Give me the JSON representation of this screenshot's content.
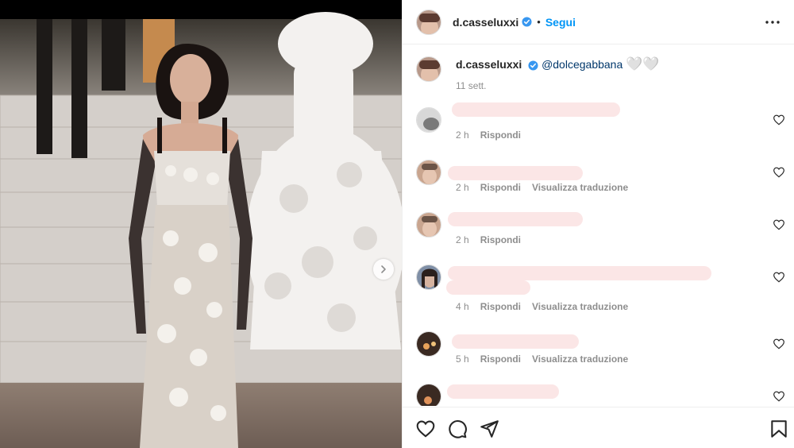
{
  "post": {
    "author": "d.casseluxxi",
    "dot": "•",
    "follow_label": "Segui",
    "more_icon": "more-horizontal-icon",
    "next_icon": "chevron-right-icon"
  },
  "caption": {
    "author": "d.casseluxxi",
    "mention": "@dolcegabbana",
    "emoji": "🤍🤍",
    "time": "11 sett."
  },
  "comments": [
    {
      "time": "2 h",
      "reply": "Rispondi",
      "translate": ""
    },
    {
      "time": "2 h",
      "reply": "Rispondi",
      "translate": "Visualizza traduzione"
    },
    {
      "time": "2 h",
      "reply": "Rispondi",
      "translate": ""
    },
    {
      "time": "4 h",
      "reply": "Rispondi",
      "translate": "Visualizza traduzione"
    },
    {
      "time": "5 h",
      "reply": "Rispondi",
      "translate": "Visualizza traduzione"
    },
    {
      "time": "",
      "reply": "",
      "translate": ""
    }
  ],
  "actions": [
    "heart-icon",
    "comment-icon",
    "share-icon",
    "bookmark-icon"
  ],
  "colors": {
    "accent": "#0095f6",
    "verified": "#3897f0",
    "muted": "#8e8e8e"
  }
}
